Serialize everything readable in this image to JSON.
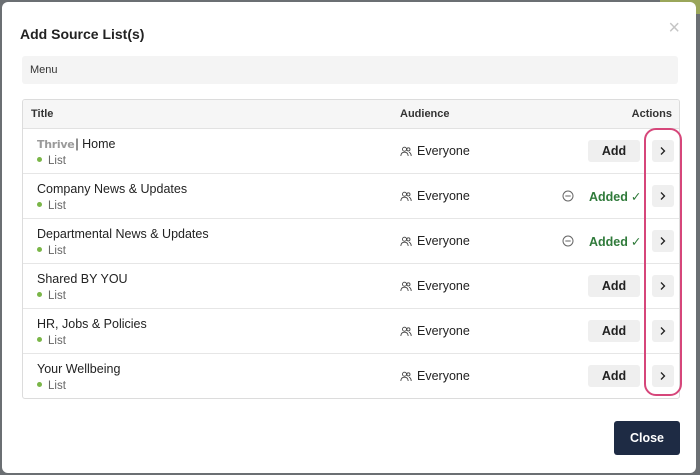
{
  "modal": {
    "title": "Add Source List(s)",
    "close_x": "×",
    "menu_label": "Menu",
    "close_button": "Close"
  },
  "table": {
    "headers": {
      "title": "Title",
      "audience": "Audience",
      "actions": "Actions"
    },
    "rows": [
      {
        "logo": "Thrive",
        "name": "| Home",
        "type": "List",
        "audience": "Everyone",
        "state": "add",
        "action_label": "Add"
      },
      {
        "logo": "",
        "name": "Company News & Updates",
        "type": "List",
        "audience": "Everyone",
        "state": "added",
        "action_label": "Added",
        "check": "✓"
      },
      {
        "logo": "",
        "name": "Departmental News & Updates",
        "type": "List",
        "audience": "Everyone",
        "state": "added",
        "action_label": "Added",
        "check": "✓"
      },
      {
        "logo": "",
        "name": "Shared BY YOU",
        "type": "List",
        "audience": "Everyone",
        "state": "add",
        "action_label": "Add"
      },
      {
        "logo": "",
        "name": "HR, Jobs & Policies",
        "type": "List",
        "audience": "Everyone",
        "state": "add",
        "action_label": "Add"
      },
      {
        "logo": "",
        "name": "Your Wellbeing",
        "type": "List",
        "audience": "Everyone",
        "state": "add",
        "action_label": "Add"
      }
    ]
  },
  "colors": {
    "added_text": "#2f7a3a",
    "list_dot": "#7ab648",
    "highlight": "#d6467a",
    "close_button_bg": "#1e2b44"
  },
  "icons": {
    "audience": "people-icon",
    "remove": "minus-circle-icon",
    "arrow": "chevron-right-icon",
    "check": "check-icon"
  }
}
